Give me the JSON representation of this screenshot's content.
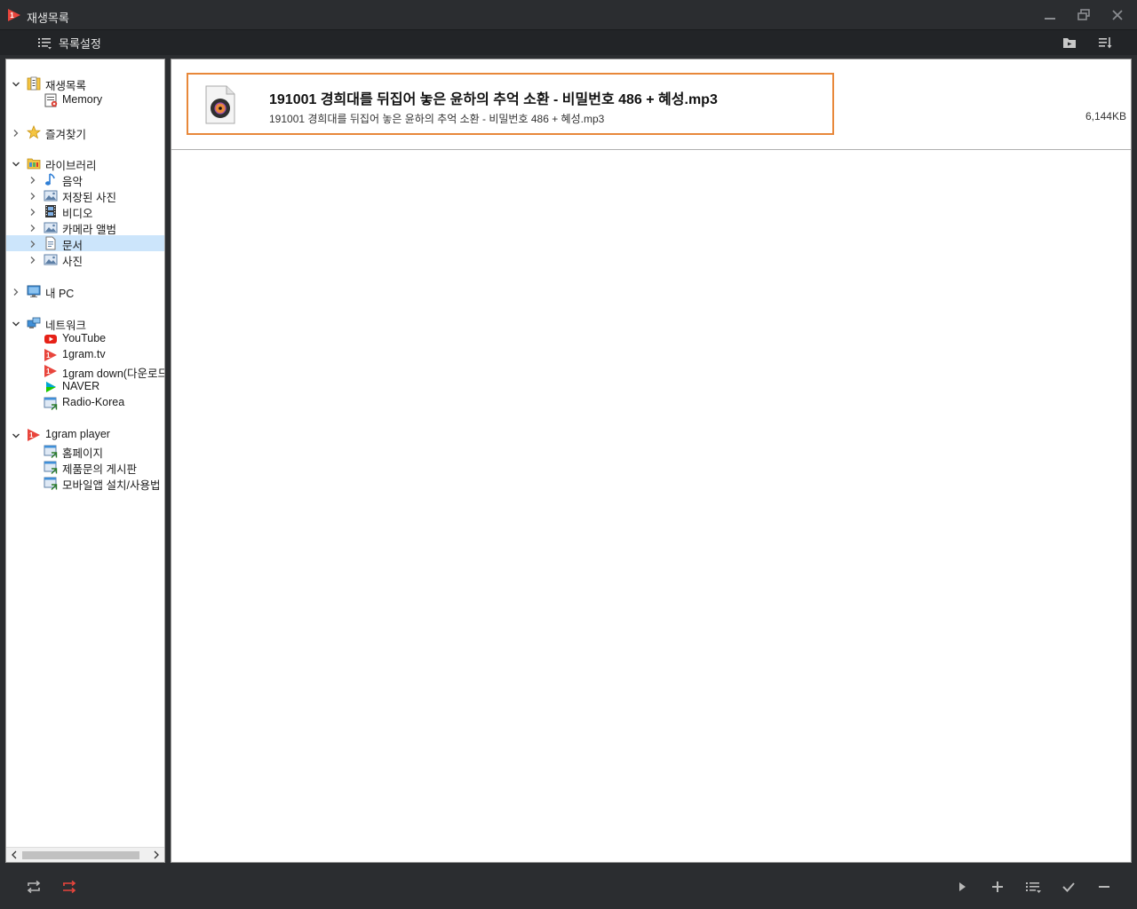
{
  "window": {
    "title": "재생목록"
  },
  "toolbar": {
    "menu_label": "목록설정"
  },
  "tree": [
    {
      "label": "재생목록",
      "icon": "playlist-folder-icon",
      "chevron": "down",
      "level": 0
    },
    {
      "label": "Memory",
      "icon": "memory-list-icon",
      "chevron": "none",
      "level": 1
    },
    {
      "label": "즐겨찾기",
      "icon": "star-icon",
      "chevron": "right",
      "level": 0
    },
    {
      "label": "라이브러리",
      "icon": "library-folder-icon",
      "chevron": "down",
      "level": 0
    },
    {
      "label": "음악",
      "icon": "music-note-icon",
      "chevron": "right",
      "level": 1
    },
    {
      "label": "저장된 사진",
      "icon": "picture-icon",
      "chevron": "right",
      "level": 1
    },
    {
      "label": "비디오",
      "icon": "film-icon",
      "chevron": "right",
      "level": 1
    },
    {
      "label": "카메라 앨범",
      "icon": "picture-icon",
      "chevron": "right",
      "level": 1
    },
    {
      "label": "문서",
      "icon": "document-icon",
      "chevron": "right",
      "level": 1,
      "selected": true
    },
    {
      "label": "사진",
      "icon": "picture-icon",
      "chevron": "right",
      "level": 1
    },
    {
      "label": "내 PC",
      "icon": "monitor-icon",
      "chevron": "right",
      "level": 0
    },
    {
      "label": "네트워크",
      "icon": "network-icon",
      "chevron": "down",
      "level": 0
    },
    {
      "label": "YouTube",
      "icon": "youtube-icon",
      "chevron": "none",
      "level": 1
    },
    {
      "label": "1gram.tv",
      "icon": "1gram-icon",
      "chevron": "none",
      "level": 1
    },
    {
      "label": "1gram down(다운로드",
      "icon": "1gram-icon",
      "chevron": "none",
      "level": 1
    },
    {
      "label": "NAVER",
      "icon": "naver-play-icon",
      "chevron": "none",
      "level": 1
    },
    {
      "label": "Radio-Korea",
      "icon": "web-link-icon",
      "chevron": "none",
      "level": 1
    },
    {
      "label": "1gram player",
      "icon": "1gram-icon",
      "chevron": "down",
      "level": 0
    },
    {
      "label": "홈페이지",
      "icon": "web-link-icon",
      "chevron": "none",
      "level": 1
    },
    {
      "label": "제품문의 게시판",
      "icon": "web-link-icon",
      "chevron": "none",
      "level": 1
    },
    {
      "label": "모바일앱 설치/사용법",
      "icon": "web-link-icon",
      "chevron": "none",
      "level": 1
    }
  ],
  "files": [
    {
      "title": "191001 경희대를 뒤집어 놓은 윤하의 추억 소환 - 비밀번호 486 + 혜성.mp3",
      "filename": "191001 경희대를 뒤집어 놓은 윤하의 추억 소환 - 비밀번호 486 + 혜성.mp3",
      "size": "6,144KB",
      "icon": "audio-file-icon"
    }
  ],
  "colors": {
    "accent": "#e8883a",
    "repeat_active": "#e8453c",
    "selection": "#cce5fb",
    "chrome": "#2b2d30"
  }
}
